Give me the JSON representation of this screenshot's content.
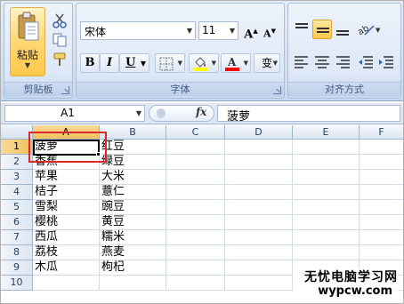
{
  "ribbon": {
    "clipboard": {
      "paste_label": "粘贴",
      "group_label": "剪贴板",
      "icons": [
        "paste-icon",
        "cut-icon",
        "copy-icon",
        "format-painter-icon"
      ]
    },
    "font": {
      "font_name": "宋体",
      "font_size": "11",
      "grow_label": "A",
      "shrink_label": "A",
      "bold_label": "B",
      "italic_label": "I",
      "underline_label": "U",
      "phonetic_label": "变",
      "group_label": "字体",
      "fill_color": "#ffff00",
      "font_color": "#ff0000"
    },
    "alignment": {
      "group_label": "对齐方式",
      "active_button": "align-middle"
    }
  },
  "formula_bar": {
    "name_box": "A1",
    "fx_label": "fx",
    "formula": "菠萝"
  },
  "sheet": {
    "columns": [
      "A",
      "B",
      "C",
      "D",
      "E",
      "F"
    ],
    "rows": [
      "1",
      "2",
      "3",
      "4",
      "5",
      "6",
      "7",
      "8",
      "9",
      "10"
    ],
    "col_a": [
      "菠萝",
      "香蕉",
      "苹果",
      "桔子",
      "雪梨",
      "樱桃",
      "西瓜",
      "荔枝",
      "木瓜",
      ""
    ],
    "col_b": [
      "红豆",
      "绿豆",
      "大米",
      "薏仁",
      "豌豆",
      "黄豆",
      "糯米",
      "燕麦",
      "枸杞",
      ""
    ],
    "selected_cell": "A1",
    "highlight_color": "#d9292f"
  },
  "watermark": {
    "title": "无忧电脑学习网",
    "url": "wypcw.com"
  }
}
